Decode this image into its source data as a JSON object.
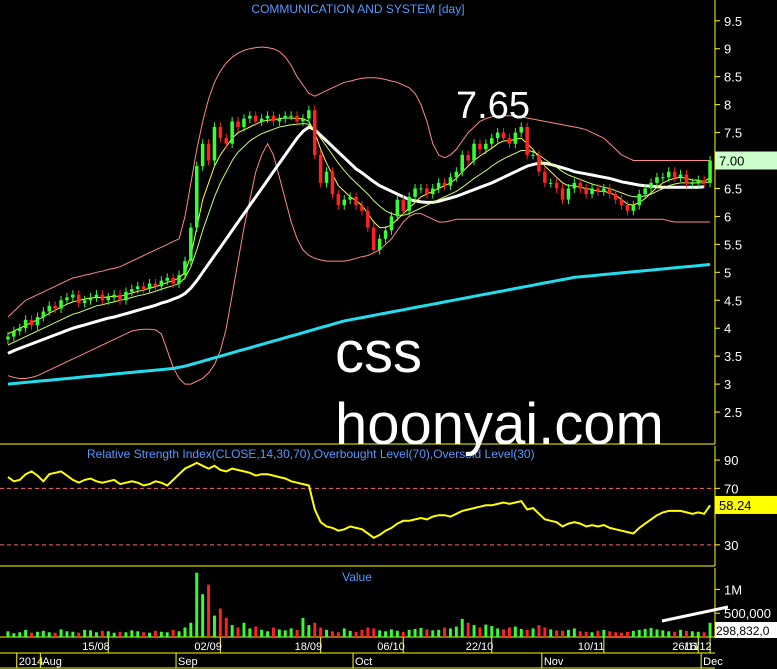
{
  "chart_data": {
    "type": "candlestick",
    "title": "COMMUNICATION AND SYSTEM [day]",
    "price_panel": {
      "ylim": [
        2.0,
        9.8
      ],
      "y_ticks": [
        "9.5",
        "9",
        "8.5",
        "8",
        "7.5",
        "7",
        "6.5",
        "6",
        "5.5",
        "5",
        "4.5",
        "4",
        "3.5",
        "3",
        "2.5"
      ],
      "last_price_label": "7.00",
      "annotation_peak": "7.65",
      "watermark_line1": "css",
      "watermark_line2": "hoonyai.com",
      "closes": [
        3.85,
        3.95,
        4.0,
        4.15,
        4.05,
        4.2,
        4.3,
        4.4,
        4.35,
        4.5,
        4.55,
        4.6,
        4.45,
        4.5,
        4.55,
        4.6,
        4.5,
        4.55,
        4.6,
        4.5,
        4.65,
        4.7,
        4.75,
        4.7,
        4.8,
        4.75,
        4.85,
        4.9,
        4.8,
        4.95,
        5.2,
        5.8,
        6.9,
        7.3,
        7.0,
        7.6,
        7.4,
        7.3,
        7.7,
        7.6,
        7.75,
        7.8,
        7.7,
        7.75,
        7.8,
        7.7,
        7.75,
        7.8,
        7.8,
        7.7,
        7.75,
        7.9,
        7.1,
        6.6,
        6.8,
        6.4,
        6.2,
        6.3,
        6.35,
        6.2,
        6.1,
        5.8,
        5.4,
        5.6,
        5.75,
        6.0,
        6.3,
        6.1,
        6.35,
        6.5,
        6.5,
        6.4,
        6.5,
        6.6,
        6.55,
        6.7,
        6.8,
        7.1,
        7.0,
        7.3,
        7.2,
        7.3,
        7.4,
        7.5,
        7.4,
        7.3,
        7.5,
        7.6,
        7.1,
        7.1,
        6.8,
        6.6,
        6.6,
        6.5,
        6.3,
        6.5,
        6.6,
        6.5,
        6.4,
        6.5,
        6.45,
        6.5,
        6.4,
        6.3,
        6.2,
        6.1,
        6.2,
        6.4,
        6.5,
        6.6,
        6.7,
        6.7,
        6.8,
        6.7,
        6.75,
        6.6,
        6.6,
        6.65,
        6.6,
        7.0
      ],
      "sma_short": [
        3.9,
        3.95,
        4.0,
        4.05,
        4.1,
        4.15,
        4.2,
        4.27,
        4.32,
        4.38,
        4.43,
        4.47,
        4.5,
        4.52,
        4.54,
        4.55,
        4.55,
        4.56,
        4.57,
        4.57,
        4.6,
        4.63,
        4.66,
        4.68,
        4.72,
        4.74,
        4.78,
        4.82,
        4.85,
        4.9,
        5.0,
        5.3,
        5.8,
        6.3,
        6.6,
        6.9,
        7.1,
        7.25,
        7.4,
        7.5,
        7.55,
        7.6,
        7.65,
        7.7,
        7.72,
        7.73,
        7.75,
        7.76,
        7.76,
        7.75,
        7.75,
        7.7,
        7.5,
        7.2,
        6.95,
        6.75,
        6.55,
        6.45,
        6.35,
        6.28,
        6.2,
        6.05,
        5.9,
        5.8,
        5.8,
        5.85,
        5.95,
        6.05,
        6.15,
        6.25,
        6.35,
        6.4,
        6.45,
        6.5,
        6.55,
        6.6,
        6.68,
        6.8,
        6.9,
        7.0,
        7.08,
        7.15,
        7.22,
        7.3,
        7.35,
        7.35,
        7.38,
        7.4,
        7.3,
        7.2,
        7.05,
        6.9,
        6.8,
        6.7,
        6.6,
        6.55,
        6.55,
        6.52,
        6.5,
        6.48,
        6.45,
        6.45,
        6.42,
        6.38,
        6.3,
        6.22,
        6.2,
        6.25,
        6.32,
        6.42,
        6.52,
        6.6,
        6.65,
        6.68,
        6.7,
        6.68,
        6.65,
        6.65,
        6.62,
        6.7
      ],
      "sma_mid": [
        3.7,
        3.75,
        3.8,
        3.85,
        3.9,
        3.95,
        4.0,
        4.05,
        4.1,
        4.15,
        4.2,
        4.25,
        4.28,
        4.32,
        4.36,
        4.4,
        4.42,
        4.45,
        4.47,
        4.5,
        4.52,
        4.55,
        4.58,
        4.6,
        4.63,
        4.66,
        4.7,
        4.73,
        4.76,
        4.8,
        4.9,
        5.1,
        5.4,
        5.75,
        6.05,
        6.35,
        6.6,
        6.8,
        7.0,
        7.15,
        7.25,
        7.35,
        7.42,
        7.48,
        7.52,
        7.56,
        7.6,
        7.62,
        7.64,
        7.65,
        7.66,
        7.65,
        7.55,
        7.4,
        7.25,
        7.1,
        6.95,
        6.82,
        6.7,
        6.6,
        6.5,
        6.4,
        6.28,
        6.18,
        6.1,
        6.05,
        6.02,
        6.02,
        6.05,
        6.1,
        6.15,
        6.2,
        6.25,
        6.3,
        6.35,
        6.4,
        6.45,
        6.52,
        6.6,
        6.68,
        6.75,
        6.82,
        6.9,
        6.97,
        7.03,
        7.08,
        7.13,
        7.18,
        7.18,
        7.16,
        7.1,
        7.02,
        6.95,
        6.88,
        6.8,
        6.74,
        6.7,
        6.66,
        6.62,
        6.58,
        6.55,
        6.52,
        6.5,
        6.46,
        6.42,
        6.38,
        6.35,
        6.35,
        6.37,
        6.4,
        6.45,
        6.5,
        6.55,
        6.58,
        6.6,
        6.6,
        6.6,
        6.6,
        6.6,
        6.62
      ],
      "sma_long": [
        3.55,
        3.6,
        3.64,
        3.68,
        3.72,
        3.76,
        3.8,
        3.84,
        3.88,
        3.92,
        3.96,
        4.0,
        4.03,
        4.06,
        4.09,
        4.12,
        4.15,
        4.18,
        4.2,
        4.23,
        4.26,
        4.29,
        4.32,
        4.35,
        4.38,
        4.41,
        4.45,
        4.48,
        4.52,
        4.56,
        4.62,
        4.72,
        4.85,
        5.0,
        5.15,
        5.3,
        5.45,
        5.6,
        5.75,
        5.9,
        6.05,
        6.2,
        6.35,
        6.5,
        6.65,
        6.8,
        6.95,
        7.1,
        7.25,
        7.4,
        7.52,
        7.6,
        7.55,
        7.45,
        7.35,
        7.25,
        7.15,
        7.05,
        6.95,
        6.85,
        6.78,
        6.7,
        6.62,
        6.55,
        6.5,
        6.45,
        6.4,
        6.35,
        6.3,
        6.28,
        6.26,
        6.25,
        6.25,
        6.27,
        6.3,
        6.33,
        6.36,
        6.4,
        6.44,
        6.48,
        6.52,
        6.56,
        6.6,
        6.65,
        6.7,
        6.75,
        6.8,
        6.85,
        6.9,
        6.93,
        6.95,
        6.95,
        6.93,
        6.9,
        6.87,
        6.84,
        6.8,
        6.78,
        6.76,
        6.74,
        6.72,
        6.7,
        6.68,
        6.65,
        6.62,
        6.6,
        6.58,
        6.56,
        6.55,
        6.54,
        6.53,
        6.52,
        6.52,
        6.52,
        6.52,
        6.52,
        6.52,
        6.52,
        6.53
      ],
      "sma_trend": [
        3.0,
        3.01,
        3.02,
        3.03,
        3.04,
        3.05,
        3.06,
        3.07,
        3.08,
        3.09,
        3.1,
        3.11,
        3.12,
        3.13,
        3.14,
        3.15,
        3.16,
        3.17,
        3.18,
        3.19,
        3.2,
        3.21,
        3.22,
        3.23,
        3.24,
        3.25,
        3.26,
        3.27,
        3.28,
        3.3,
        3.32,
        3.35,
        3.38,
        3.41,
        3.44,
        3.47,
        3.5,
        3.53,
        3.56,
        3.59,
        3.62,
        3.65,
        3.68,
        3.71,
        3.74,
        3.77,
        3.8,
        3.83,
        3.86,
        3.89,
        3.92,
        3.95,
        3.98,
        4.01,
        4.04,
        4.07,
        4.1,
        4.13,
        4.15,
        4.17,
        4.19,
        4.21,
        4.23,
        4.25,
        4.27,
        4.29,
        4.31,
        4.33,
        4.35,
        4.37,
        4.39,
        4.41,
        4.43,
        4.45,
        4.47,
        4.49,
        4.51,
        4.53,
        4.55,
        4.57,
        4.59,
        4.61,
        4.63,
        4.65,
        4.67,
        4.69,
        4.71,
        4.73,
        4.75,
        4.77,
        4.79,
        4.81,
        4.83,
        4.85,
        4.87,
        4.89,
        4.91,
        4.92,
        4.93,
        4.94,
        4.95,
        4.96,
        4.97,
        4.98,
        4.99,
        5.0,
        5.01,
        5.02,
        5.03,
        5.04,
        5.05,
        5.06,
        5.07,
        5.08,
        5.09,
        5.1,
        5.11,
        5.12,
        5.13,
        5.14
      ],
      "bb_upper": [
        4.2,
        4.3,
        4.4,
        4.5,
        4.55,
        4.6,
        4.65,
        4.7,
        4.75,
        4.8,
        4.85,
        4.9,
        4.92,
        4.95,
        4.97,
        5.0,
        5.02,
        5.05,
        5.07,
        5.1,
        5.15,
        5.2,
        5.25,
        5.3,
        5.35,
        5.4,
        5.45,
        5.5,
        5.55,
        5.6,
        6.0,
        6.6,
        7.2,
        7.7,
        8.1,
        8.4,
        8.6,
        8.75,
        8.85,
        8.92,
        8.97,
        9.0,
        9.02,
        9.03,
        9.02,
        9.0,
        8.95,
        8.85,
        8.7,
        8.5,
        8.35,
        8.2,
        8.15,
        8.2,
        8.25,
        8.3,
        8.35,
        8.4,
        8.42,
        8.45,
        8.47,
        8.48,
        8.48,
        8.47,
        8.45,
        8.42,
        8.4,
        8.35,
        8.3,
        8.2,
        8.0,
        7.7,
        7.3,
        7.1,
        7.05,
        7.1,
        7.2,
        7.35,
        7.5,
        7.6,
        7.7,
        7.75,
        7.78,
        7.8,
        7.8,
        7.8,
        7.8,
        7.78,
        7.76,
        7.74,
        7.72,
        7.7,
        7.68,
        7.66,
        7.64,
        7.62,
        7.6,
        7.58,
        7.55,
        7.5,
        7.45,
        7.4,
        7.3,
        7.2,
        7.1,
        7.05,
        7.0,
        7.0,
        7.0,
        7.0,
        7.0,
        7.0,
        7.0,
        7.0,
        7.0,
        7.0,
        7.0,
        7.0,
        7.0,
        7.0
      ],
      "bb_lower": [
        3.15,
        3.12,
        3.1,
        3.1,
        3.12,
        3.15,
        3.2,
        3.25,
        3.3,
        3.35,
        3.4,
        3.45,
        3.5,
        3.55,
        3.6,
        3.65,
        3.7,
        3.75,
        3.8,
        3.85,
        3.9,
        3.95,
        3.97,
        3.98,
        3.98,
        3.97,
        3.9,
        3.6,
        3.3,
        3.1,
        3.0,
        3.0,
        3.05,
        3.1,
        3.2,
        3.35,
        3.6,
        4.0,
        4.6,
        5.2,
        5.8,
        6.3,
        6.8,
        7.1,
        7.3,
        7.1,
        6.7,
        6.3,
        5.9,
        5.6,
        5.4,
        5.3,
        5.25,
        5.22,
        5.2,
        5.2,
        5.2,
        5.2,
        5.22,
        5.25,
        5.28,
        5.3,
        5.35,
        5.4,
        5.5,
        5.6,
        5.75,
        5.9,
        6.0,
        6.05,
        6.05,
        6.0,
        5.95,
        5.9,
        5.9,
        5.92,
        5.95,
        5.95,
        5.95,
        5.95,
        5.95,
        5.95,
        5.95,
        5.95,
        5.95,
        5.95,
        5.95,
        5.95,
        5.95,
        5.95,
        5.95,
        5.95,
        5.95,
        5.95,
        5.95,
        5.95,
        5.95,
        5.95,
        5.95,
        5.95,
        5.95,
        5.95,
        5.95,
        5.95,
        5.95,
        5.95,
        5.95,
        5.95,
        5.95,
        5.95,
        5.95,
        5.95,
        5.92,
        5.9,
        5.9,
        5.9,
        5.9,
        5.9,
        5.9,
        5.9
      ]
    },
    "rsi_panel": {
      "label": "Relative Strength Index(CLOSE,14,30,70),Overbought Level(70),Oversold Level(30)",
      "ylim": [
        15,
        100
      ],
      "y_ticks": [
        "90",
        "70",
        "30"
      ],
      "last_value_label": "58.24",
      "values": [
        78,
        75,
        76,
        80,
        82,
        79,
        75,
        80,
        81,
        82,
        79,
        76,
        74,
        76,
        77,
        75,
        74,
        75,
        76,
        73,
        74,
        75,
        74,
        72,
        73,
        75,
        74,
        72,
        76,
        80,
        84,
        86,
        88,
        86,
        84,
        86,
        83,
        82,
        84,
        83,
        82,
        81,
        79,
        80,
        80,
        79,
        78,
        77,
        75,
        74,
        73,
        72,
        55,
        46,
        43,
        42,
        40,
        41,
        43,
        42,
        41,
        38,
        35,
        37,
        40,
        42,
        45,
        47,
        47,
        48,
        49,
        48,
        50,
        51,
        51,
        50,
        52,
        54,
        55,
        56,
        57,
        58,
        58,
        59,
        60,
        59,
        60,
        61,
        55,
        56,
        52,
        48,
        47,
        46,
        43,
        45,
        46,
        45,
        43,
        44,
        43,
        44,
        42,
        41,
        40,
        39,
        38,
        42,
        45,
        48,
        51,
        53,
        54,
        54,
        54,
        53,
        52,
        53,
        52,
        58
      ]
    },
    "volume_panel": {
      "label": "Value",
      "y_ticks": [
        "1M",
        "500,000"
      ],
      "last_value_label": "298,832,0",
      "values": [
        120000,
        80000,
        100000,
        150000,
        90000,
        110000,
        130000,
        100000,
        90000,
        160000,
        120000,
        110000,
        90000,
        150000,
        140000,
        100000,
        130000,
        120000,
        90000,
        110000,
        100000,
        140000,
        120000,
        100000,
        90000,
        130000,
        110000,
        100000,
        150000,
        120000,
        200000,
        300000,
        1350000,
        900000,
        1100000,
        450000,
        600000,
        400000,
        250000,
        200000,
        300000,
        180000,
        220000,
        150000,
        120000,
        200000,
        160000,
        140000,
        180000,
        150000,
        400000,
        250000,
        300000,
        200000,
        150000,
        120000,
        100000,
        180000,
        130000,
        110000,
        150000,
        200000,
        180000,
        140000,
        120000,
        160000,
        130000,
        110000,
        150000,
        170000,
        190000,
        160000,
        140000,
        150000,
        200000,
        180000,
        220000,
        380000,
        300000,
        250000,
        200000,
        260000,
        230000,
        180000,
        160000,
        200000,
        220000,
        170000,
        150000,
        180000,
        250000,
        200000,
        160000,
        140000,
        130000,
        150000,
        180000,
        120000,
        110000,
        100000,
        130000,
        150000,
        120000,
        100000,
        90000,
        110000,
        130000,
        150000,
        170000,
        190000,
        160000,
        140000,
        120000,
        110000,
        150000,
        130000,
        120000,
        110000,
        100000,
        298832
      ]
    },
    "x_axis": {
      "top_labels": [
        {
          "i": 2,
          "t": "2014"
        },
        {
          "i": 6,
          "t": "Aug"
        },
        {
          "i": 29,
          "t": "Sep"
        },
        {
          "i": 59,
          "t": "Oct"
        },
        {
          "i": 91,
          "t": "Nov"
        },
        {
          "i": 118,
          "t": "Dec"
        }
      ],
      "bottom_labels": [
        {
          "i": 17,
          "t": "15/08"
        },
        {
          "i": 36,
          "t": "02/09"
        },
        {
          "i": 53,
          "t": "18/09"
        },
        {
          "i": 67,
          "t": "06/10"
        },
        {
          "i": 82,
          "t": "22/10"
        },
        {
          "i": 101,
          "t": "10/11"
        },
        {
          "i": 117,
          "t": "26/11"
        },
        {
          "i": 131,
          "t": "16/12"
        }
      ]
    },
    "colors": {
      "up": "#33ff33",
      "down": "#ff2222",
      "sma_short": "#ffff33",
      "sma_mid": "#ccff66",
      "sma_long": "#ffffff",
      "sma_trend": "#22ddee",
      "bollinger": "#ff8888",
      "axis": "#ffff00",
      "title": "#5599ff",
      "rsi": "#ffff00",
      "label_bg": "#ccffcc"
    }
  }
}
